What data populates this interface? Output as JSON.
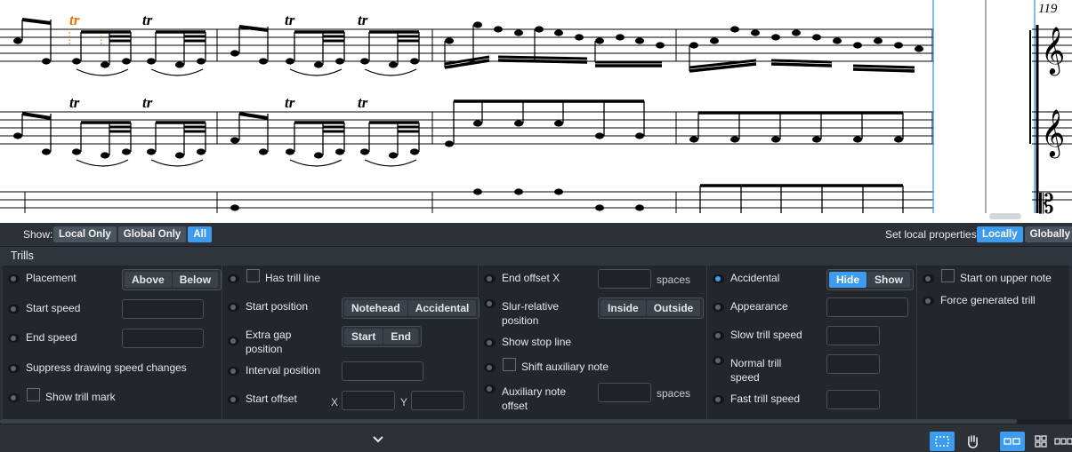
{
  "score": {
    "measure_number": "119",
    "trill_mark": "tr"
  },
  "filter_bar": {
    "show_label": "Show:",
    "show_options": [
      "Local Only",
      "Global Only",
      "All"
    ],
    "show_selected": "All",
    "set_label": "Set local properties:",
    "set_options": [
      "Locally",
      "Globally"
    ],
    "set_selected": "Locally"
  },
  "group": {
    "title": "Trills"
  },
  "columns": {
    "c1": {
      "placement": "Placement",
      "placement_above": "Above",
      "placement_below": "Below",
      "start_speed": "Start speed",
      "end_speed": "End speed",
      "suppress": "Suppress drawing speed changes",
      "show_trill_mark": "Show trill mark"
    },
    "c2": {
      "has_trill_line": "Has trill line",
      "start_position": "Start position",
      "start_notehead": "Notehead",
      "start_accidental": "Accidental",
      "extra_gap_1": "Extra gap",
      "extra_gap_2": "position",
      "gap_start": "Start",
      "gap_end": "End",
      "interval_position": "Interval position",
      "start_offset": "Start offset",
      "x": "X",
      "y": "Y"
    },
    "c3": {
      "end_offset_x": "End offset X",
      "end_offset_unit": "spaces",
      "slur_1": "Slur-relative",
      "slur_2": "position",
      "slur_inside": "Inside",
      "slur_outside": "Outside",
      "show_stop_line": "Show stop line",
      "shift_aux": "Shift auxiliary note",
      "aux_1": "Auxiliary note",
      "aux_2": "offset",
      "aux_unit": "spaces"
    },
    "c4": {
      "accidental": "Accidental",
      "acc_hide": "Hide",
      "acc_show": "Show",
      "appearance": "Appearance",
      "slow_trill_speed": "Slow trill speed",
      "normal_1": "Normal trill",
      "normal_2": "speed",
      "fast_trill_speed": "Fast trill speed"
    },
    "c5": {
      "start_upper": "Start on upper note",
      "force_generated": "Force generated trill"
    }
  },
  "colors": {
    "accent": "#3d9cf0",
    "selection": "#e8780c",
    "panel": "#23272c"
  },
  "status_bar": {
    "icons": [
      "chevron-down-icon",
      "marquee-select-icon",
      "hand-pan-icon",
      "galley-view-icon",
      "page-view-icon",
      "continuous-view-icon"
    ]
  }
}
